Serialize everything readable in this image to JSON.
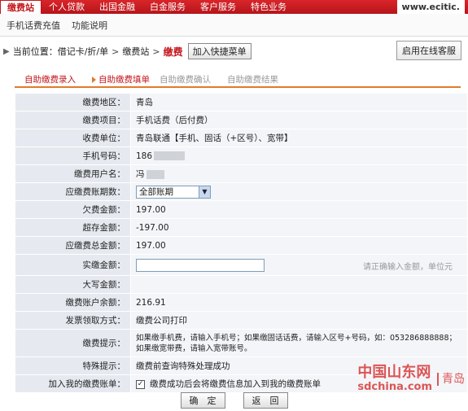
{
  "topnav": {
    "items": [
      "缴费站",
      "个人贷款",
      "出国金融",
      "白金服务",
      "客户服务",
      "特色业务"
    ],
    "site": "www.ecitic."
  },
  "subnav": {
    "items": [
      "手机话费充值",
      "功能说明"
    ]
  },
  "breadcrumb": {
    "prefix": "当前位置：",
    "items": [
      "借记卡/折/单",
      "缴费站"
    ],
    "current": "缴费",
    "shortcut": "加入快捷菜单"
  },
  "online_button": "启用在线客服",
  "steps": [
    "自助缴费录入",
    "自助缴费填单",
    "自助缴费确认",
    "自助缴费结果"
  ],
  "form": {
    "region_label": "缴费地区：",
    "region": "青岛",
    "item_label": "缴费项目：",
    "item": "手机话费（后付费）",
    "unit_label": "收费单位：",
    "unit": "青岛联通【手机、固话（+区号）、宽带】",
    "phone_label": "手机号码：",
    "phone": "186",
    "user_label": "缴费用户名：",
    "user": "冯",
    "period_label": "应缴费账期数：",
    "period": "全部账期",
    "owed_label": "欠费金额：",
    "owed": "197.00",
    "over_label": "超存金额：",
    "over": "-197.00",
    "total_label": "应缴费总金额：",
    "total": "197.00",
    "paid_label": "实缴金额：",
    "paid_hint": "请正确输入金额，单位元",
    "upper_label": "大写金额：",
    "balance_label": "缴费账户余额：",
    "balance": "216.91",
    "invoice_label": "发票领取方式：",
    "invoice": "缴费公司打印",
    "tip_label": "缴费提示：",
    "tip": "如果缴手机费，请输入手机号；如果缴固话话费，请输入区号+号码，如：053286888888；如果缴宽带费，请输入宽带账号。",
    "special_label": "特殊提示：",
    "special": "缴费前查询特殊处理成功",
    "bill_label": "加入我的缴费账单：",
    "bill": "缴费成功后会将缴费信息加入到我的缴费账单"
  },
  "buttons": {
    "confirm": "确　定",
    "back": "返　回"
  },
  "watermark": {
    "main": "中国山东网",
    "sub": "sdchina.com",
    "city": "青岛"
  }
}
